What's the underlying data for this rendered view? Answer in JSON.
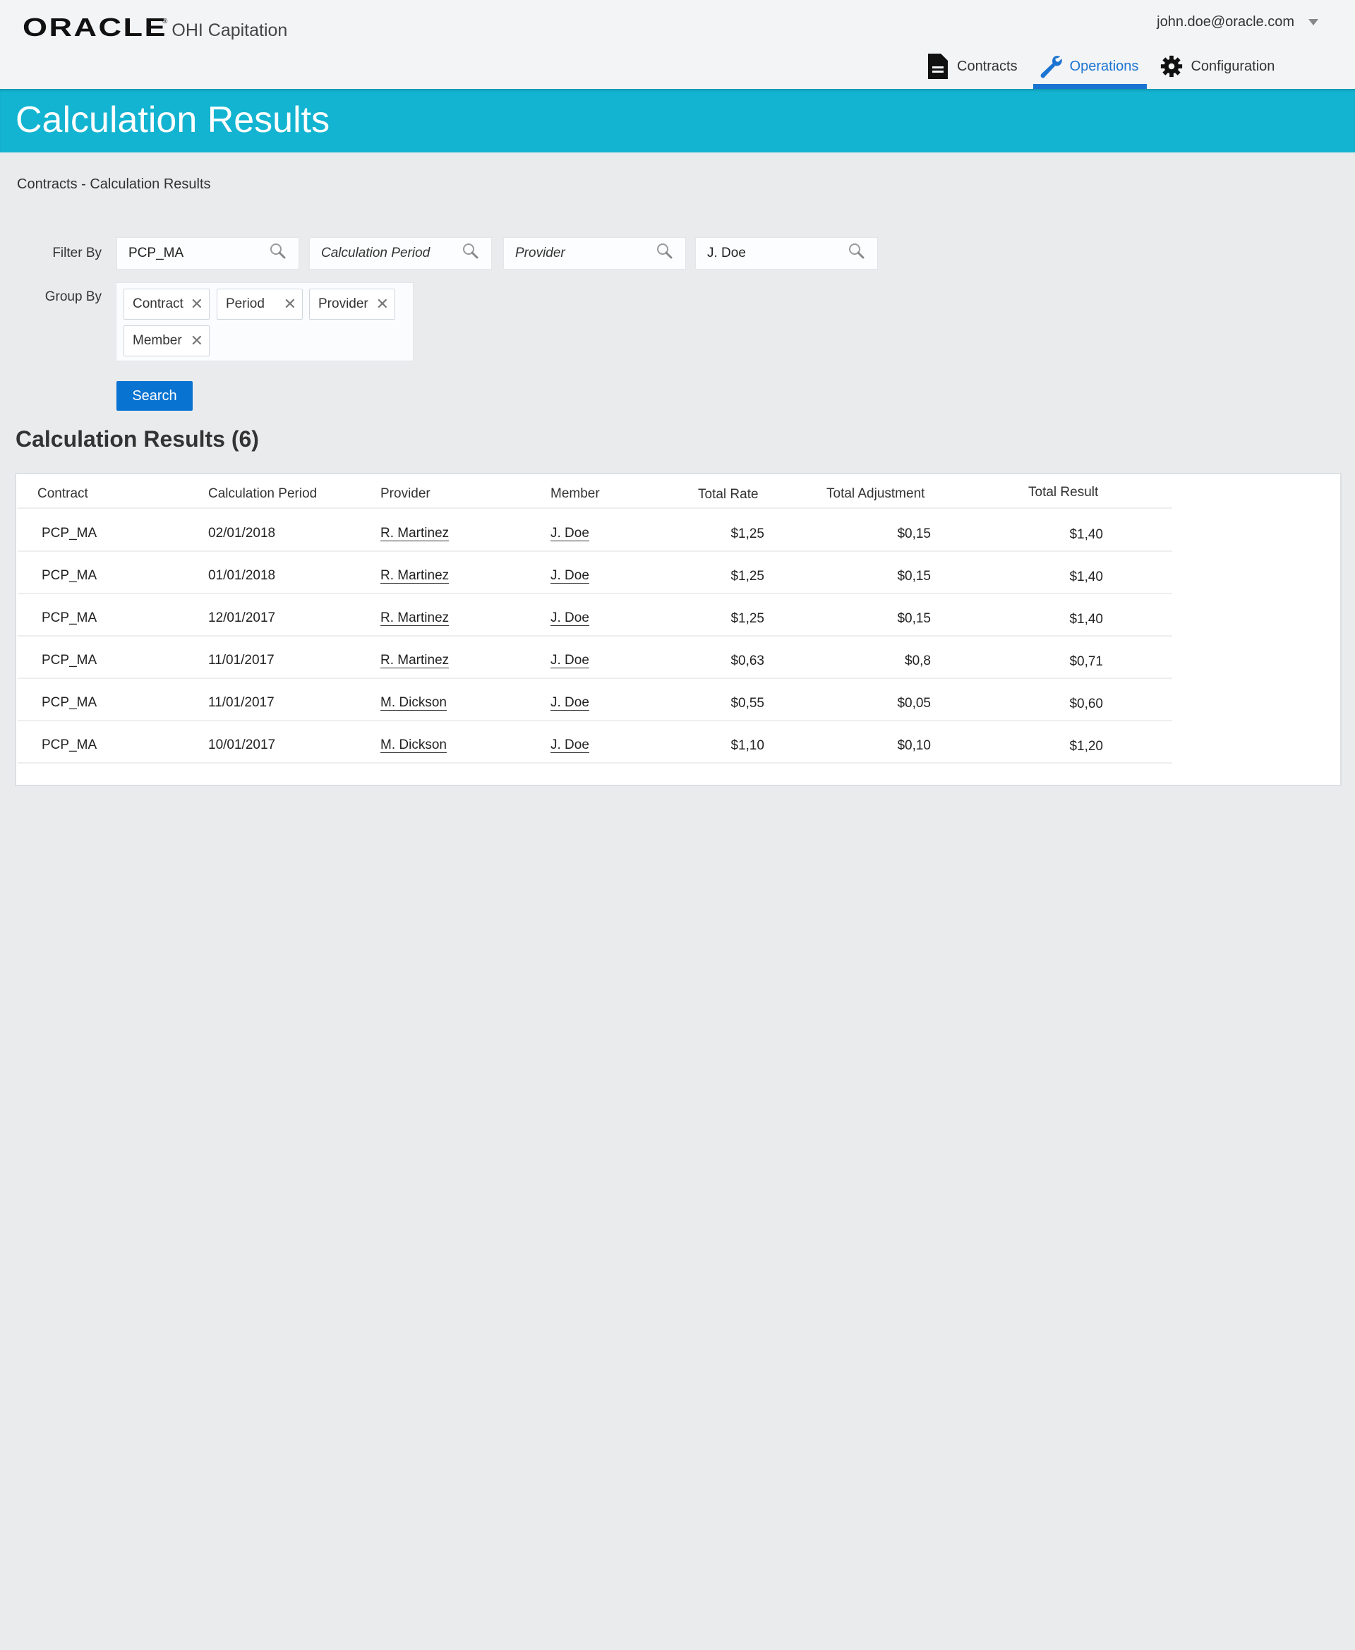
{
  "header": {
    "logo_brand": "ORACLE",
    "logo_reg": "®",
    "product_name": "OHI Capitation",
    "user_email": "john.doe@oracle.com",
    "nav": [
      {
        "label": "Contracts",
        "icon": "document-icon",
        "active": false
      },
      {
        "label": "Operations",
        "icon": "wrench-icon",
        "active": true
      },
      {
        "label": "Configuration",
        "icon": "gear-icon",
        "active": false
      }
    ]
  },
  "colors": {
    "title_band": "#13b4d1",
    "accent_blue": "#1b74d1",
    "button_blue": "#0973d1",
    "background": "#eaebed"
  },
  "page": {
    "title": "Calculation Results",
    "breadcrumb": "Contracts - Calculation Results"
  },
  "filters": {
    "filter_by_label": "Filter By",
    "group_by_label": "Group By",
    "inputs": [
      {
        "name": "contract",
        "value": "PCP_MA",
        "placeholder": false
      },
      {
        "name": "calculation-period",
        "value": "Calculation Period",
        "placeholder": true
      },
      {
        "name": "provider",
        "value": "Provider",
        "placeholder": true
      },
      {
        "name": "member",
        "value": "J. Doe",
        "placeholder": false
      }
    ],
    "group_chips": [
      "Contract",
      "Period",
      "Provider",
      "Member"
    ],
    "search_label": "Search"
  },
  "results": {
    "title": "Calculation Results (6)",
    "columns": [
      "Contract",
      "Calculation Period",
      "Provider",
      "Member",
      "Total Rate",
      "Total Adjustment",
      "Total Result"
    ],
    "rows": [
      [
        "PCP_MA",
        "02/01/2018",
        "R. Martinez",
        "J. Doe",
        "$1,25",
        "$0,15",
        "$1,40"
      ],
      [
        "PCP_MA",
        "01/01/2018",
        "R. Martinez",
        "J. Doe",
        "$1,25",
        "$0,15",
        "$1,40"
      ],
      [
        "PCP_MA",
        "12/01/2017",
        "R. Martinez",
        "J. Doe",
        "$1,25",
        "$0,15",
        "$1,40"
      ],
      [
        "PCP_MA",
        "11/01/2017",
        "R. Martinez",
        "J. Doe",
        "$0,63",
        "$0,8",
        "$0,71"
      ],
      [
        "PCP_MA",
        "11/01/2017",
        "M. Dickson",
        "J. Doe",
        "$0,55",
        "$0,05",
        "$0,60"
      ],
      [
        "PCP_MA",
        "10/01/2017",
        "M. Dickson",
        "J. Doe",
        "$1,10",
        "$0,10",
        "$1,20"
      ]
    ]
  }
}
